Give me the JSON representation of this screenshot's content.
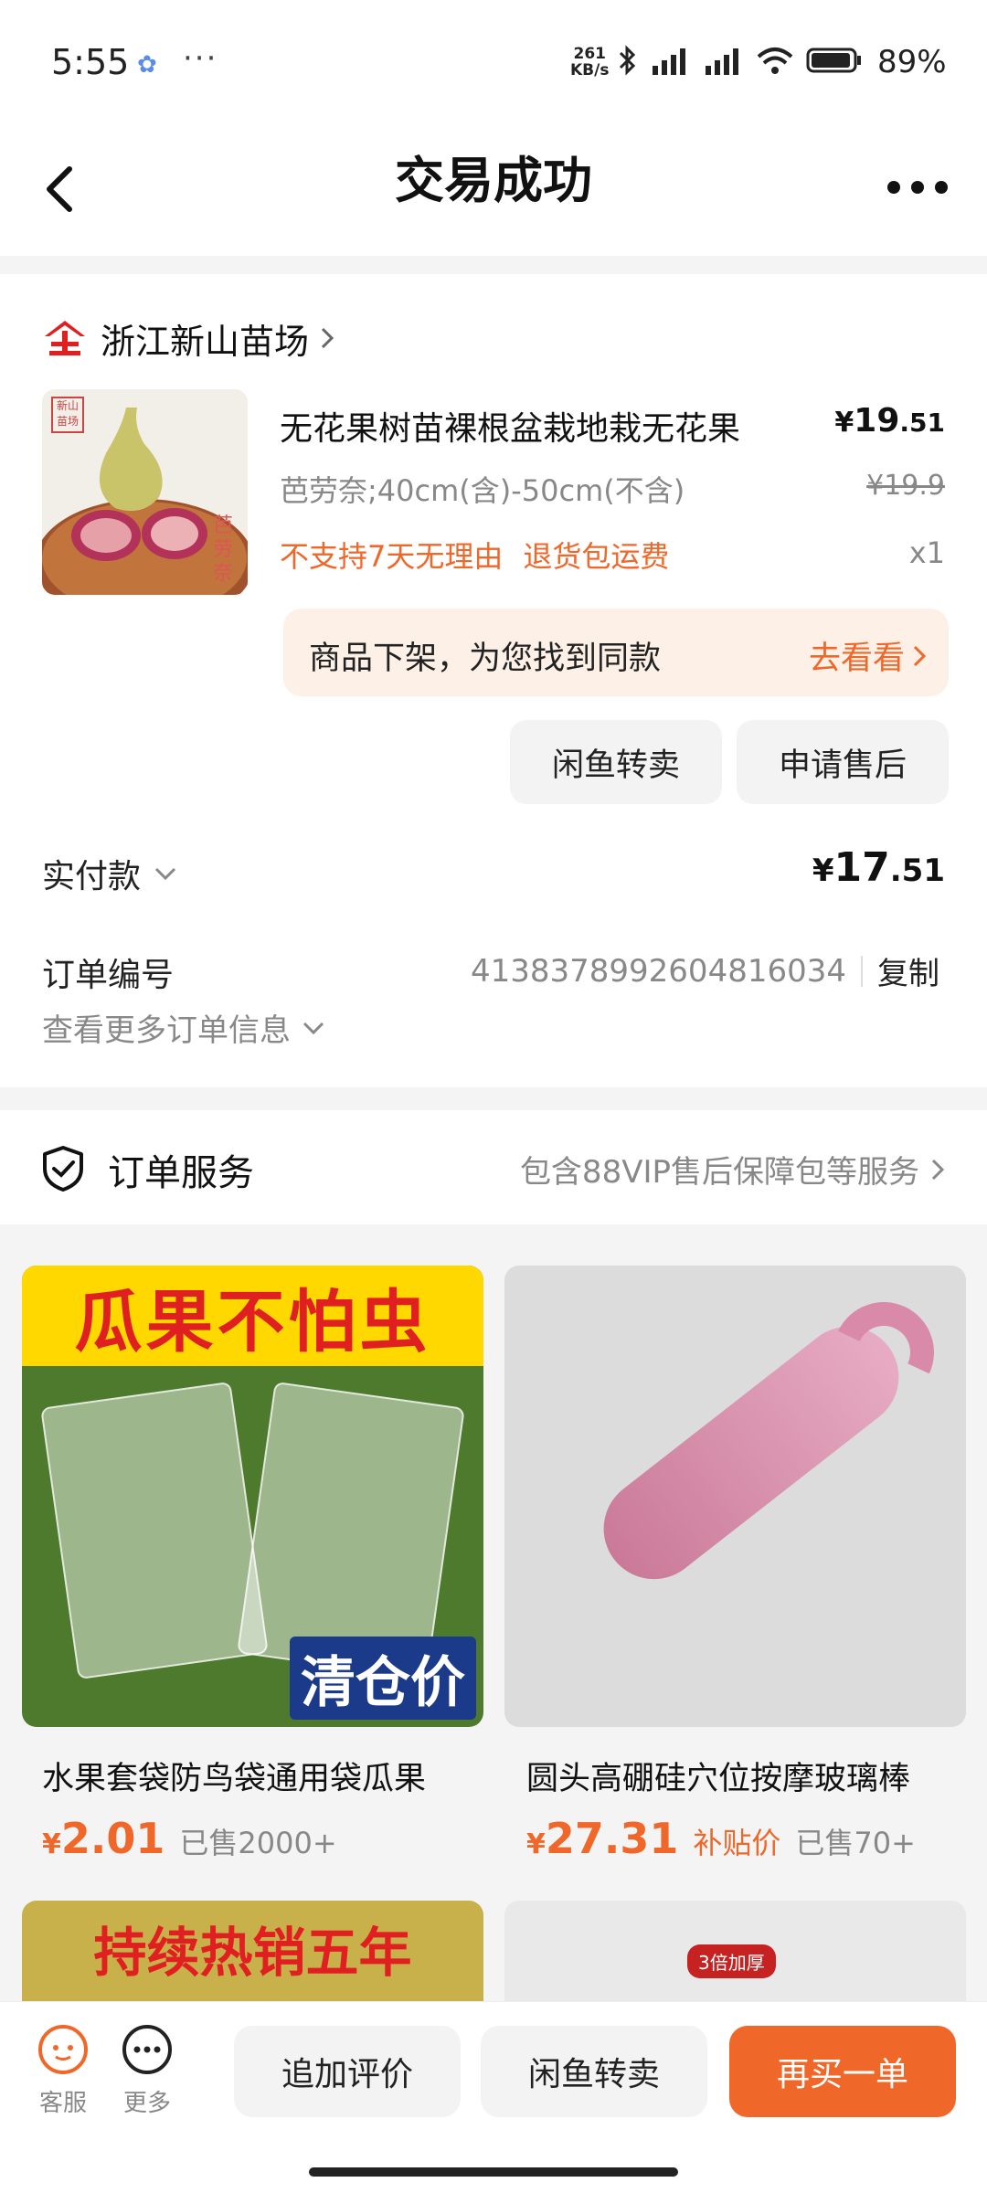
{
  "status_bar": {
    "time": "5:55",
    "speed_value": "261",
    "speed_unit": "KB/s",
    "battery": "89%"
  },
  "nav": {
    "title": "交易成功"
  },
  "order": {
    "shop_name": "浙江新山苗场",
    "product_image_stamp": "新山苗场",
    "product_image_caption": "芭劳奈",
    "product_title": "无花果树苗裸根盆栽地栽无花果",
    "price_yen": "¥",
    "price_int": "19",
    "price_dec": ".51",
    "sku": "芭劳奈;40cm(含)-50cm(不含)",
    "original_price": "¥19.9",
    "tag_no_return": "不支持7天无理由",
    "tag_free_return": "退货包运费",
    "quantity": "x1",
    "similar_notice": "商品下架，为您找到同款",
    "similar_action": "去看看",
    "btn_resell": "闲鱼转卖",
    "btn_after_sales": "申请售后",
    "paid_label": "实付款",
    "paid_yen": "¥",
    "paid_int": "17",
    "paid_dec": ".51",
    "order_no_label": "订单编号",
    "order_no": "4138378992604816034",
    "copy_label": "复制",
    "more_info": "查看更多订单信息"
  },
  "service": {
    "title": "订单服务",
    "desc": "包含88VIP售后保障包等服务"
  },
  "recommendations": [
    {
      "banner": "瓜果不怕虫",
      "tag": "清仓价",
      "title": "水果套袋防鸟袋通用袋瓜果",
      "price_yen": "¥",
      "price": "2.01",
      "sold": "已售2000+"
    },
    {
      "title": "圆头高硼硅穴位按摩玻璃棒",
      "price_yen": "¥",
      "price": "27.31",
      "subsidy": "补贴价",
      "sold": "已售70+"
    }
  ],
  "recommendations_row2": {
    "left_banner": "持续热销五年",
    "right_badge": "3倍加厚"
  },
  "bottom_bar": {
    "customer_service": "客服",
    "more": "更多",
    "add_review": "追加评价",
    "resell": "闲鱼转卖",
    "buy_again": "再买一单"
  },
  "colors": {
    "accent": "#f0672a",
    "shop_logo": "#e02020"
  }
}
